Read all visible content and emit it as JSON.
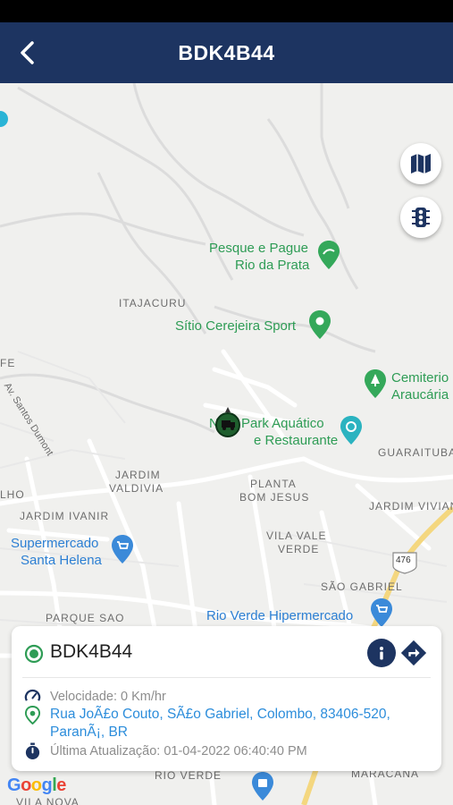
{
  "header": {
    "title": "BDK4B44",
    "back_icon": "chevron-left-icon"
  },
  "colors": {
    "header_bg": "#1d3461",
    "online_green": "#2e9c55",
    "link_blue": "#2c8ddb",
    "navy": "#1d3461"
  },
  "map": {
    "area_labels": [
      "ITAJACURU",
      "JARDIM",
      "VALDIVIA",
      "JARDIM IVANIR",
      "PLANTA",
      "BOM JESUS",
      "GUARAITUBA",
      "JARDIM VIVIAN",
      "VILA VALE",
      "VERDE",
      "SÃO GABRIEL",
      "PARQUE SAO",
      "LHO",
      "FE",
      "RIO VERDE",
      "MARACANA",
      "VILA NOVA"
    ],
    "street_label": "Av. Santos Dumont",
    "route_shield": "476",
    "pois": [
      {
        "line1": "Pesque e Pague",
        "line2": "Rio da Prata"
      },
      {
        "line1": "Sítio Cerejeira Sport",
        "line2": ""
      },
      {
        "line1": "Cemiterio",
        "line2": "Araucária"
      },
      {
        "line1": "Park Aquático",
        "line2": "e Restaurante"
      },
      {
        "line1": "Supermercado",
        "line2": "Santa Helena"
      },
      {
        "line1": "Rio Verde Hipermercado",
        "line2": ""
      }
    ],
    "poi_prefix_fragment": "N",
    "attribution": "Google",
    "controls": {
      "map_type_icon": "map-icon",
      "traffic_icon": "traffic-light-icon"
    }
  },
  "card": {
    "plate": "BDK4B44",
    "speed": "Velocidade: 0 Km/hr",
    "address": "Rua JoÃ£o Couto, SÃ£o Gabriel, Colombo, 83406-520, ParanÃ¡, BR",
    "updated": "Última Atualização: 01-04-2022 06:40:40 PM",
    "icons": {
      "status": "online-status-icon",
      "info": "info-icon",
      "directions": "directions-icon",
      "speed": "speedometer-icon",
      "location": "location-pin-icon",
      "time": "stopwatch-icon"
    }
  }
}
